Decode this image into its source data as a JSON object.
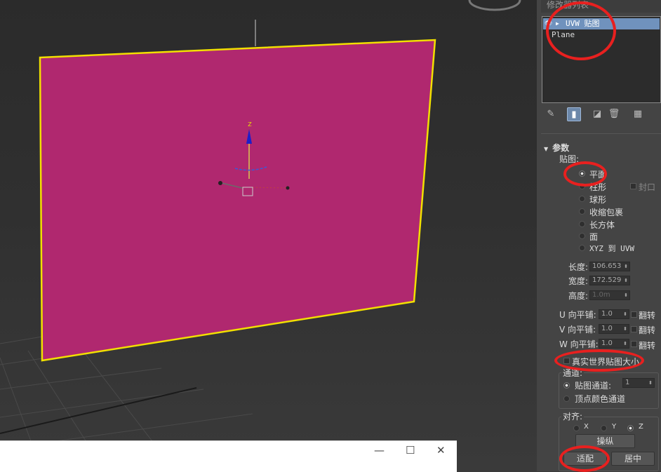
{
  "viewport": {
    "gizmo_axis_z": "Z",
    "plane_color": "#b0286f",
    "selection_color": "#f2e000"
  },
  "panel": {
    "header": "修改器列表",
    "stack_items": [
      {
        "label": "UVW 贴图",
        "selected": true
      },
      {
        "label": "Plane",
        "selected": false
      }
    ],
    "toolbar_icons": [
      "pin-icon",
      "show-end-result-icon",
      "make-unique-icon",
      "remove-modifier-icon",
      "configure-icon"
    ],
    "rollout_title": "参数",
    "mapping_label": "贴图:",
    "mapping_options": [
      {
        "label": "平面",
        "selected": true
      },
      {
        "label": "柱形",
        "selected": false
      },
      {
        "label": "球形",
        "selected": false
      },
      {
        "label": "收缩包裹",
        "selected": false
      },
      {
        "label": "长方体",
        "selected": false
      },
      {
        "label": "面",
        "selected": false
      },
      {
        "label": "XYZ 到 UVW",
        "selected": false
      }
    ],
    "cap_label": "封口",
    "length_label": "长度:",
    "length_value": "106.653",
    "width_label": "宽度:",
    "width_value": "172.529",
    "height_label": "高度:",
    "height_value": "1.0m",
    "tile_rows": [
      {
        "label": "U 向平铺:",
        "value": "1.0",
        "flip": "翻转"
      },
      {
        "label": "V 向平铺:",
        "value": "1.0",
        "flip": "翻转"
      },
      {
        "label": "W 向平铺:",
        "value": "1.0",
        "flip": "翻转"
      }
    ],
    "real_world_label": "真实世界贴图大小",
    "channel_group_title": "通道:",
    "map_channel_label": "贴图通道:",
    "map_channel_value": "1",
    "vertex_color_label": "顶点颜色通道",
    "align_group_title": "对齐:",
    "align_axes": [
      {
        "label": "X",
        "selected": false
      },
      {
        "label": "Y",
        "selected": false
      },
      {
        "label": "Z",
        "selected": true
      }
    ],
    "manipulate_label": "操纵",
    "fit_label": "适配",
    "center_label": "居中"
  },
  "popup": {
    "minimize": "—",
    "maximize": "☐",
    "close": "✕"
  }
}
